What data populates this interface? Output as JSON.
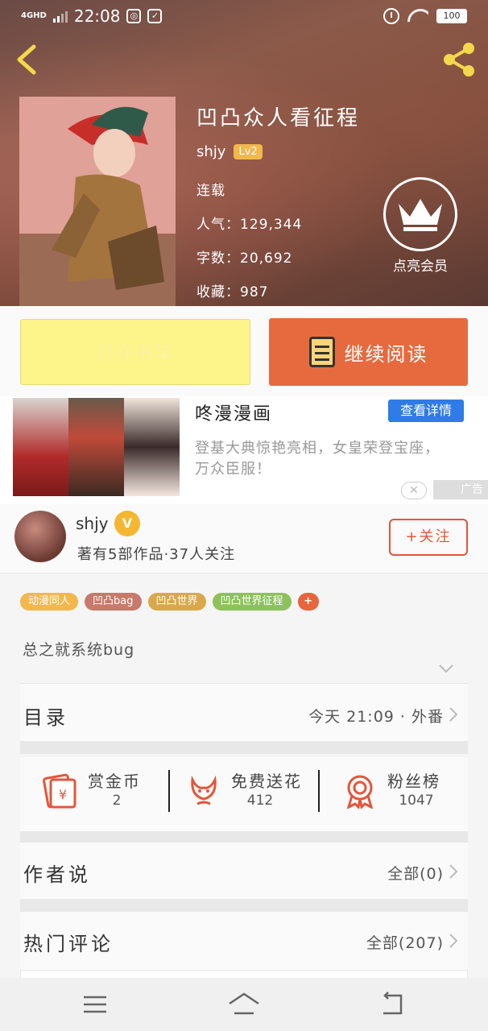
{
  "status_bar": {
    "network": "4GHD",
    "time": "22:08",
    "battery": "100"
  },
  "book": {
    "title": "凹凸众人看征程",
    "author": "shjy",
    "author_level": "Lv2",
    "status": "连载",
    "popularity": "人气：129,344",
    "word_count": "字数：20,692",
    "favorites": "收藏：987"
  },
  "vip": {
    "label": "点亮会员"
  },
  "actions": {
    "shelf_label": "已在书架",
    "read_label": "继续阅读"
  },
  "ad": {
    "title": "咚漫漫画",
    "detail_button": "查看详情",
    "description": "登基大典惊艳亮相，女皇荣登宝座，万众臣服！",
    "close_glyph": "✕",
    "tag": "广告"
  },
  "author_card": {
    "name": "shjy",
    "badge": "V",
    "stats": "著有5部作品·37人关注",
    "follow_button": "+关注"
  },
  "tags": [
    {
      "label": "动漫同人",
      "color": "#f2b84c"
    },
    {
      "label": "凹凸bag",
      "color": "#c77a6b"
    },
    {
      "label": "凹凸世界",
      "color": "#d9a84a"
    },
    {
      "label": "凹凸世界征程",
      "color": "#8dc25a"
    },
    {
      "label": "+",
      "color": "#e8643c"
    }
  ],
  "summary": "总之就系统bug",
  "catalog": {
    "title": "目录",
    "latest": "今天 21:09 · 外番"
  },
  "stats": [
    {
      "label": "赏金币",
      "value": "2",
      "icon": "red-envelope-icon"
    },
    {
      "label": "免费送花",
      "value": "412",
      "icon": "flower-icon"
    },
    {
      "label": "粉丝榜",
      "value": "1047",
      "icon": "medal-icon"
    }
  ],
  "author_says": {
    "title": "作者说",
    "link": "全部(0)"
  },
  "hot_comments": {
    "title": "热门评论",
    "link": "全部(207)"
  },
  "colors": {
    "accent": "#e76a3e",
    "shelf": "#fdf48a",
    "ad_button": "#2f7be8",
    "follow": "#e3563a"
  }
}
